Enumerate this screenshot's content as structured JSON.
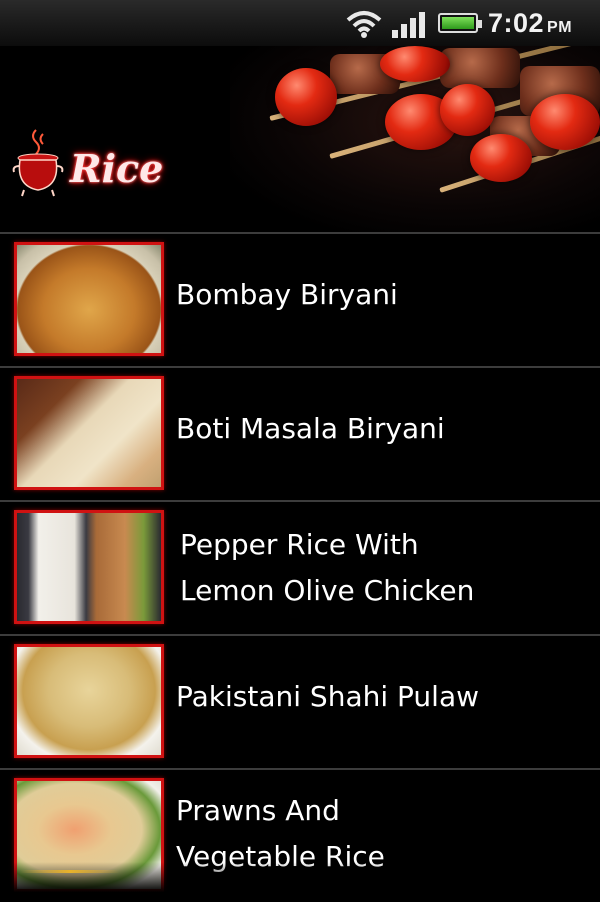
{
  "status_bar": {
    "time": "7:02",
    "ampm": "PM",
    "icons": [
      "wifi-icon",
      "signal-icon",
      "battery-icon"
    ],
    "battery_color": "#3fc21f"
  },
  "header": {
    "title": "Rice",
    "logo_icon": "cooking-pot-icon",
    "banner": "skewers-banner",
    "title_glow_color": "#d40000"
  },
  "recipes": [
    {
      "label": "Bombay Biryani",
      "thumb": "bombay-biryani-photo"
    },
    {
      "label": "Boti Masala Biryani",
      "thumb": "boti-masala-biryani-photo"
    },
    {
      "label": "Pepper Rice With\nLemon Olive Chicken",
      "thumb": "pepper-rice-photo"
    },
    {
      "label": "Pakistani Shahi Pulaw",
      "thumb": "shahi-pulaw-photo"
    },
    {
      "label": "Prawns And\nVegetable Rice",
      "thumb": "prawns-vegetable-rice-photo"
    }
  ],
  "theme": {
    "accent": "#d01212",
    "background": "#000000",
    "divider": "#3c3c3c"
  }
}
